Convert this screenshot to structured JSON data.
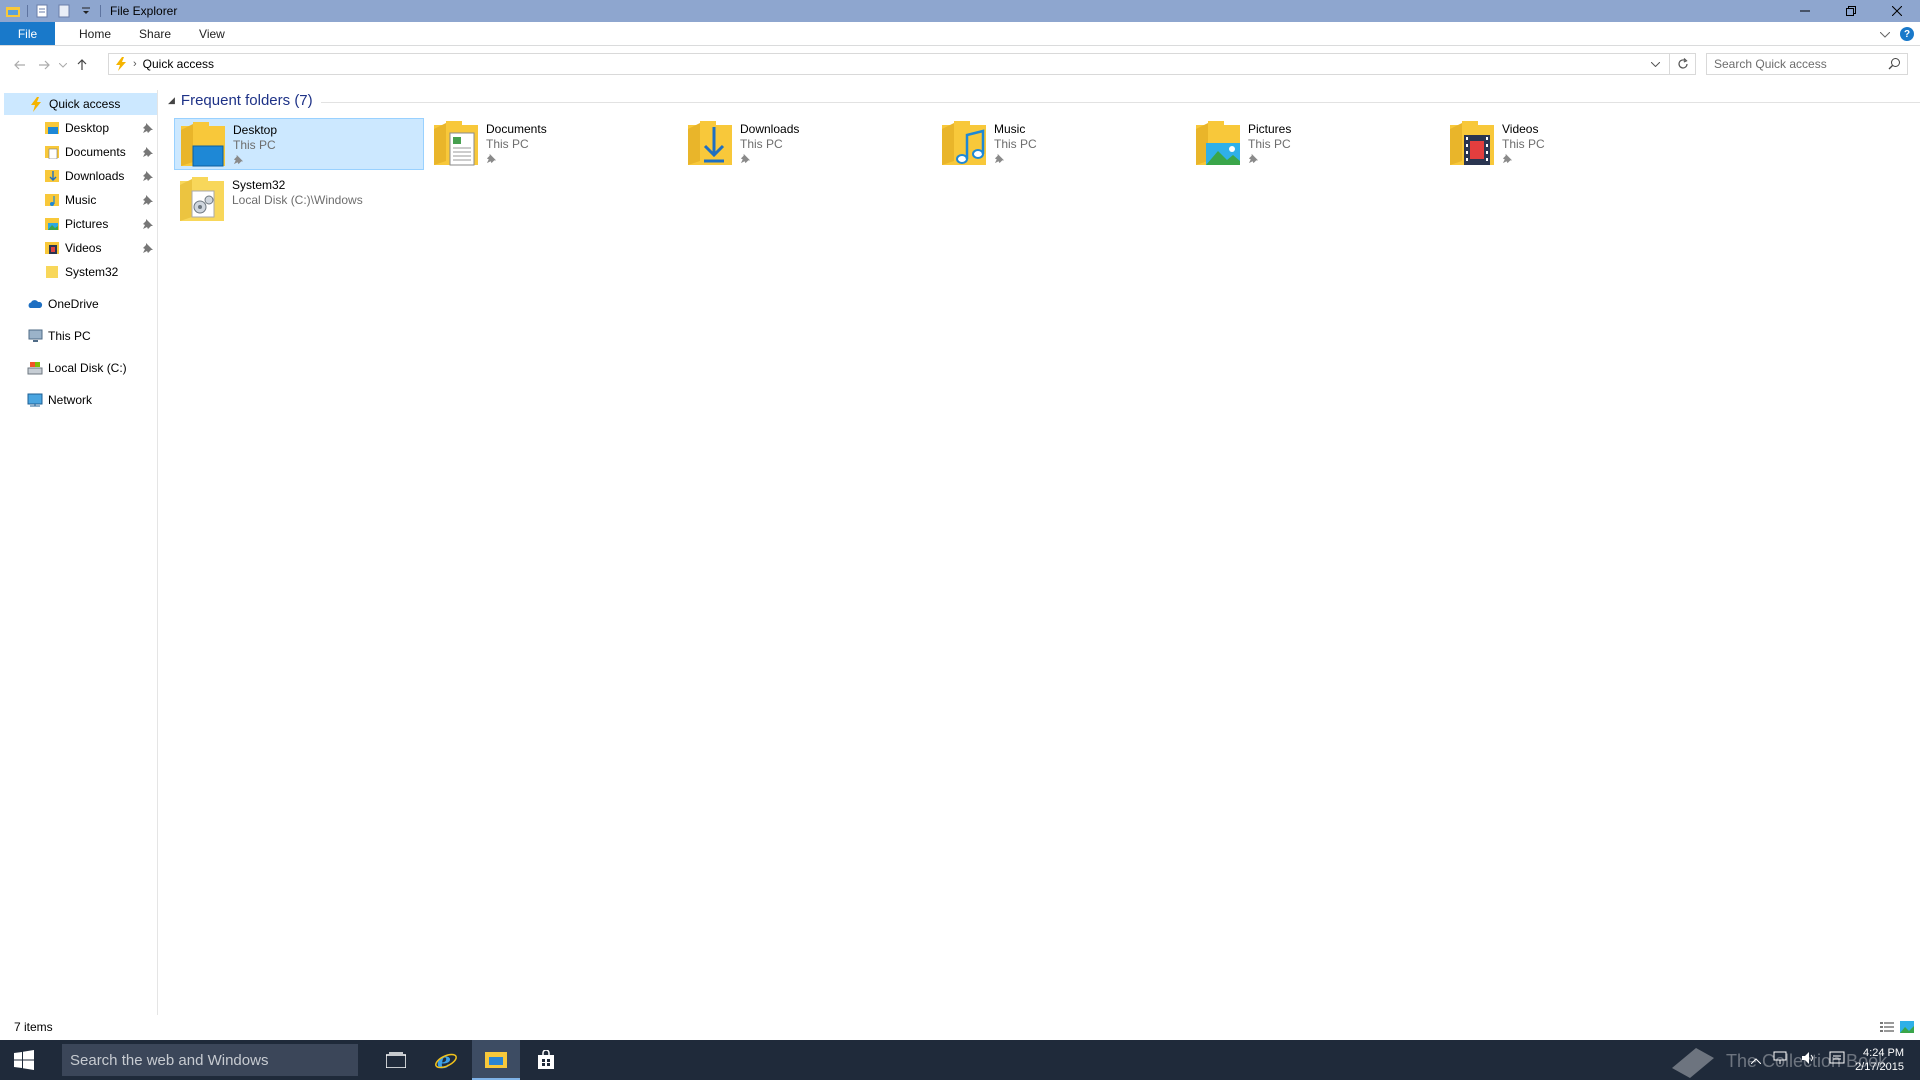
{
  "window": {
    "title": "File Explorer"
  },
  "ribbon": {
    "tabs": [
      "File",
      "Home",
      "Share",
      "View"
    ]
  },
  "address": {
    "crumb": "Quick access",
    "search_placeholder": "Search Quick access"
  },
  "nav": {
    "quick_access": "Quick access",
    "pinned": [
      {
        "label": "Desktop",
        "icon": "desktop-folder-icon",
        "pinned": true
      },
      {
        "label": "Documents",
        "icon": "documents-folder-icon",
        "pinned": true
      },
      {
        "label": "Downloads",
        "icon": "downloads-folder-icon",
        "pinned": true
      },
      {
        "label": "Music",
        "icon": "music-folder-icon",
        "pinned": true
      },
      {
        "label": "Pictures",
        "icon": "pictures-folder-icon",
        "pinned": true
      },
      {
        "label": "Videos",
        "icon": "videos-folder-icon",
        "pinned": true
      },
      {
        "label": "System32",
        "icon": "folder-icon",
        "pinned": false
      }
    ],
    "roots": [
      {
        "label": "OneDrive",
        "icon": "onedrive-icon"
      },
      {
        "label": "This PC",
        "icon": "this-pc-icon"
      },
      {
        "label": "Local Disk (C:)",
        "icon": "local-disk-icon"
      },
      {
        "label": "Network",
        "icon": "network-icon"
      }
    ]
  },
  "content": {
    "group_title": "Frequent folders (7)",
    "folders": [
      {
        "name": "Desktop",
        "location": "This PC",
        "icon": "desktop-folder-icon",
        "selected": true
      },
      {
        "name": "Documents",
        "location": "This PC",
        "icon": "documents-folder-icon"
      },
      {
        "name": "Downloads",
        "location": "This PC",
        "icon": "downloads-folder-icon"
      },
      {
        "name": "Music",
        "location": "This PC",
        "icon": "music-folder-icon"
      },
      {
        "name": "Pictures",
        "location": "This PC",
        "icon": "pictures-folder-icon"
      },
      {
        "name": "Videos",
        "location": "This PC",
        "icon": "videos-folder-icon"
      },
      {
        "name": "System32",
        "location": "Local Disk (C:)\\Windows",
        "icon": "system-folder-icon"
      }
    ]
  },
  "status": {
    "count": "7 items"
  },
  "taskbar": {
    "search_placeholder": "Search the web and Windows",
    "time": "4:24 PM",
    "date": "2/17/2015",
    "watermark": "The Collection Book"
  },
  "colors": {
    "accent": "#1979ca",
    "titlebar": "#8ea6cf",
    "selection": "#cce8ff",
    "taskbar": "#1f2a3a",
    "folder_yellow": "#f8c83a"
  }
}
